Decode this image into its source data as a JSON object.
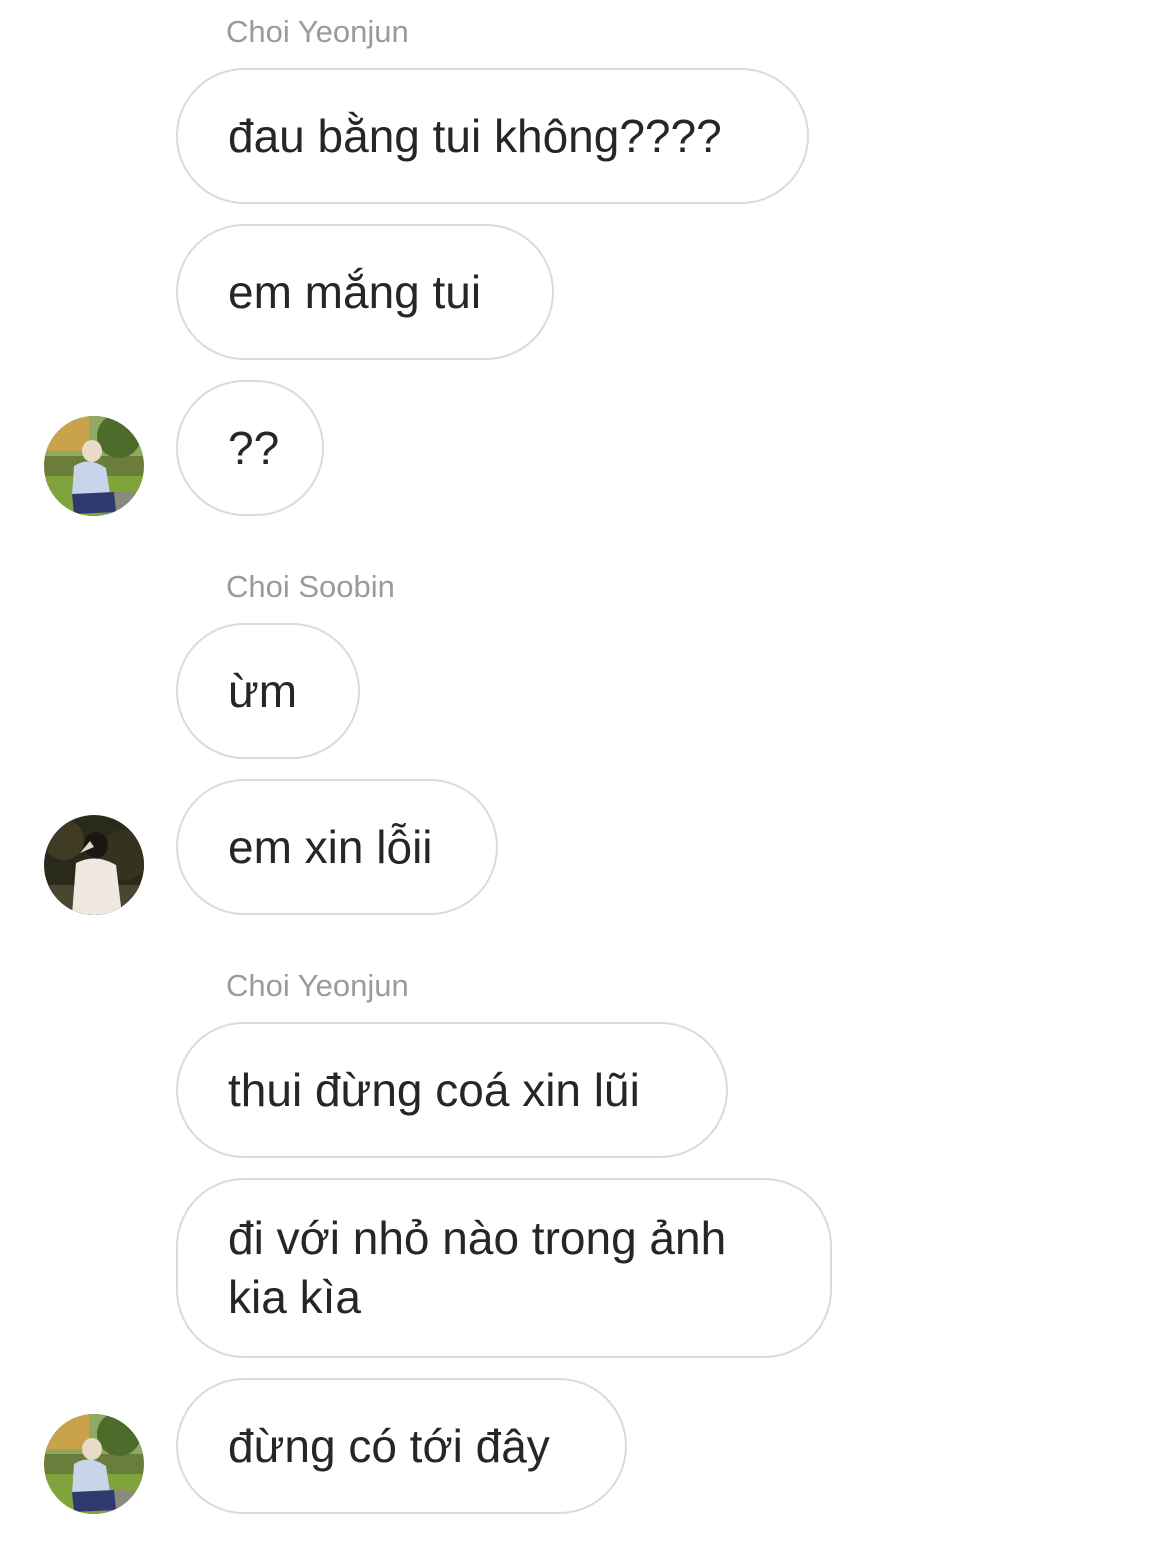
{
  "groups": [
    {
      "sender": "Choi Yeonjun",
      "messages": [
        {
          "lines": [
            "đau bằng tui không????"
          ]
        },
        {
          "lines": [
            "em mắng tui"
          ]
        },
        {
          "lines": [
            "??"
          ]
        }
      ],
      "avatar": "avatar-yeonjun-photo"
    },
    {
      "sender": "Choi Soobin",
      "messages": [
        {
          "lines": [
            "ừm"
          ]
        },
        {
          "lines": [
            "em xin lỗii"
          ]
        }
      ],
      "avatar": "avatar-soobin-photo"
    },
    {
      "sender": "Choi Yeonjun",
      "messages": [
        {
          "lines": [
            "thui đừng coá xin lũi"
          ]
        },
        {
          "lines": [
            "đi với nhỏ nào trong ảnh",
            "kia kìa"
          ]
        },
        {
          "lines": [
            "đừng có tới đây"
          ]
        }
      ],
      "avatar": "avatar-yeonjun-photo"
    }
  ],
  "colors": {
    "background": "#ffffff",
    "bubble_border": "#dbdbdb",
    "message_text": "#262626",
    "sender_text": "#9b9b9b"
  }
}
